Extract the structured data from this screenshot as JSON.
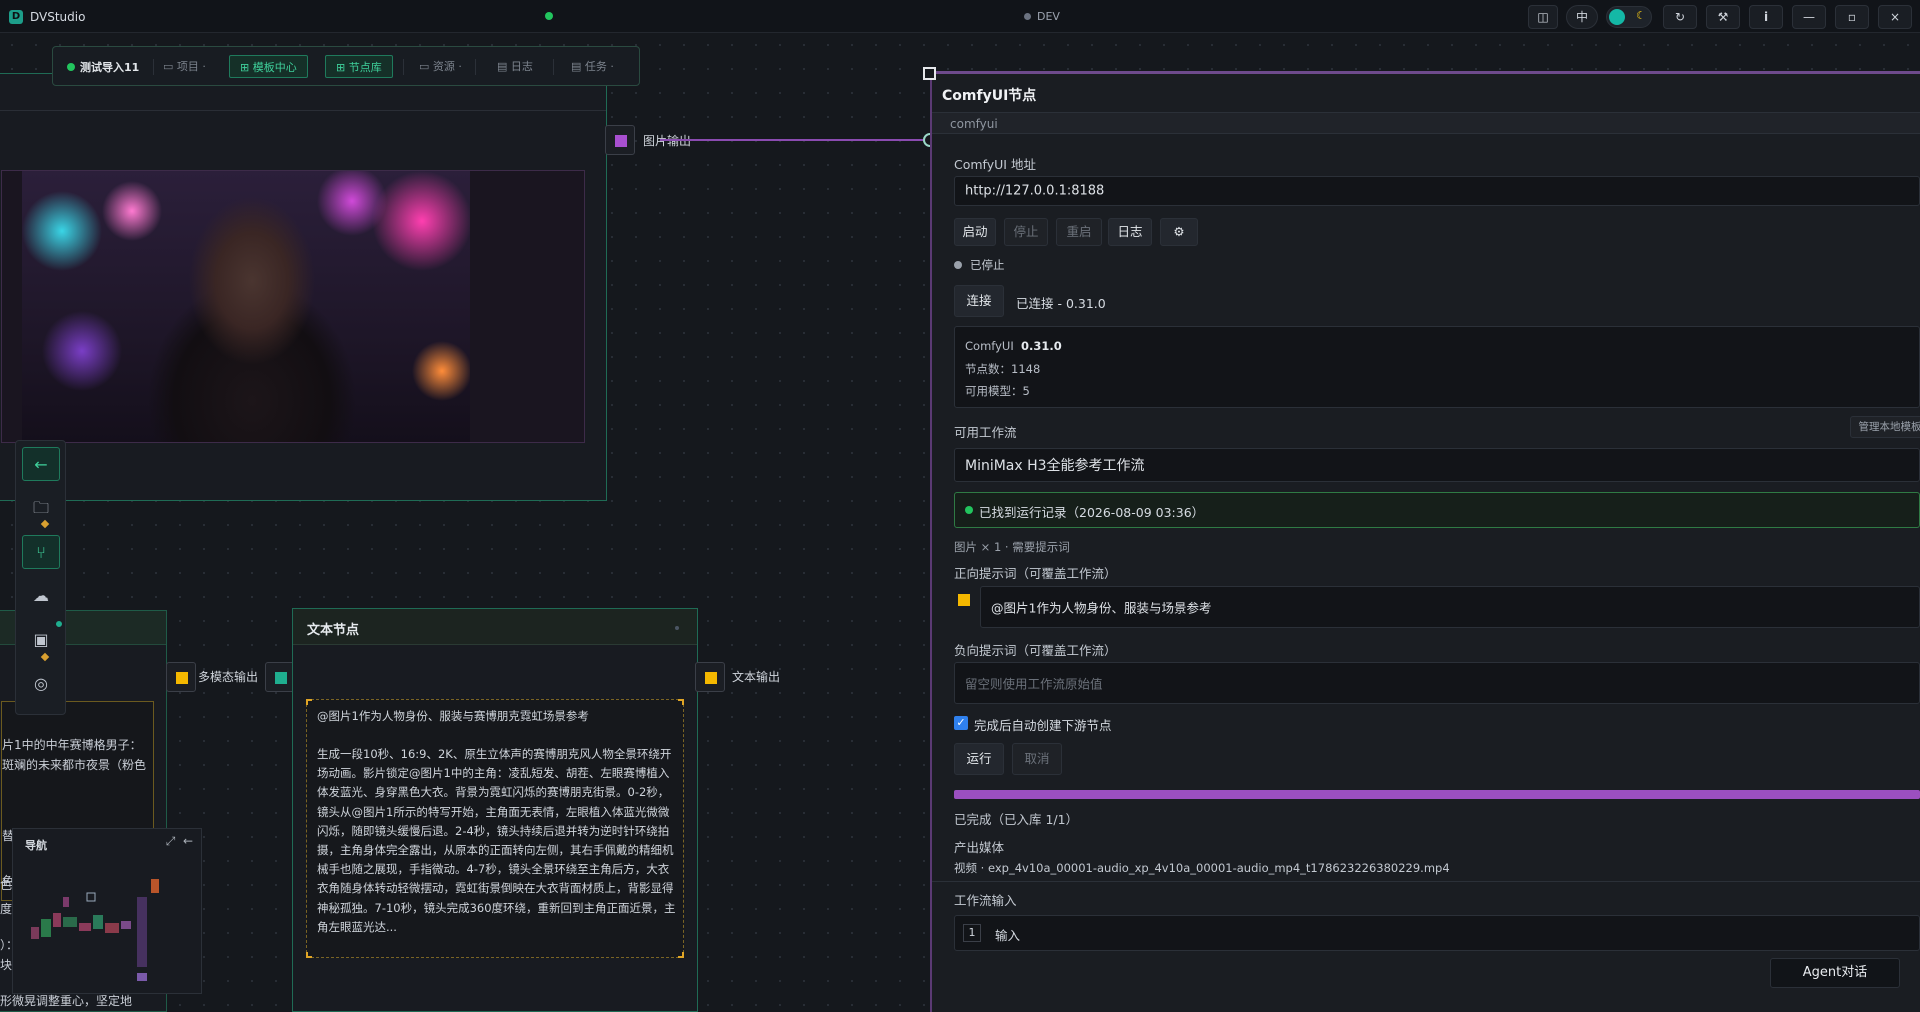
{
  "titlebar": {
    "app_title": "DVStudio",
    "env_label": "DEV",
    "lang_button": "中",
    "refresh_icon": "↻",
    "tools_icon": "⚒",
    "info_icon": "i",
    "minimize_icon": "—",
    "maximize_icon": "▫",
    "close_icon": "×"
  },
  "toolbar": {
    "project_name": "测试导入11",
    "tabs": [
      {
        "label": "项目",
        "icon": "folder-icon"
      },
      {
        "label": "模板中心",
        "icon": "grid-icon"
      },
      {
        "label": "节点库",
        "icon": "grid-icon"
      },
      {
        "label": "资源",
        "icon": "folder-icon"
      },
      {
        "label": "日志",
        "icon": "log-icon"
      },
      {
        "label": "任务",
        "icon": "task-icon"
      }
    ]
  },
  "image_node": {
    "output_port_label": "图片输出"
  },
  "left_node": {
    "port_label": "多模态输出",
    "lines": [
      "片1中的中年赛博格男子：",
      "斑斓的未来都市夜景（粉色",
      "替",
      "色",
      "度",
      "）：",
      "块",
      "形微晃调整重心，坚定地"
    ]
  },
  "navigator": {
    "title": "导航"
  },
  "text_node": {
    "title": "文本节点",
    "output_label": "文本输出",
    "line1": "@图片1作为人物身份、服装与赛博朋克霓虹场景参考",
    "body": "生成一段10秒、16:9、2K、原生立体声的赛博朋克风人物全景环绕开场动画。影片锁定@图片1中的主角：凌乱短发、胡茬、左眼赛博植入体发蓝光、身穿黑色大衣。背景为霓虹闪烁的赛博朋克街景。0-2秒，镜头从@图片1所示的特写开始，主角面无表情，左眼植入体蓝光微微闪烁，随即镜头缓慢后退。2-4秒，镜头持续后退并转为逆时针环绕拍摄，主角身体完全露出，从原本的正面转向左侧，其右手佩戴的精细机械手也随之展现，手指微动。4-7秒，镜头全景环绕至主角后方，大衣衣角随身体转动轻微摆动，霓虹街景倒映在大衣背面材质上，背影显得神秘孤独。7-10秒，镜头完成360度环绕，重新回到主角正面近景，主角左眼蓝光达..."
  },
  "panel": {
    "title": "ComfyUI节点",
    "subtitle": "comfyui",
    "address_label": "ComfyUI 地址",
    "address_value": "http://127.0.0.1:8188",
    "buttons": {
      "start": "启动",
      "stop": "停止",
      "restart": "重启",
      "log": "日志",
      "settings": "⚙"
    },
    "status": "已停止",
    "connect_button": "连接",
    "connected_text": "已连接 - 0.31.0",
    "info": {
      "line1_label": "ComfyUI",
      "line1_value": "0.31.0",
      "line2": "节点数：1148",
      "line3": "可用模型：5"
    },
    "workflows_label": "可用工作流",
    "manage_button": "管理本地模板",
    "workflow_selected": "MiniMax H3全能参考工作流",
    "found_record": "已找到运行记录（2026-08-09 03:36）",
    "requirement": "图片 × 1 · 需要提示词",
    "positive_label": "正向提示词（可覆盖工作流）",
    "positive_value": "@图片1作为人物身份、服装与场景参考",
    "negative_label": "负向提示词（可覆盖工作流）",
    "negative_placeholder": "留空则使用工作流原始值",
    "auto_create_label": "完成后自动创建下游节点",
    "run_button": "运行",
    "cancel_button": "取消",
    "progress": 1.0,
    "done_text": "已完成（已入库 1/1）",
    "output_media_label": "产出媒体",
    "output_media_value": "视频 · exp_4v10a_00001-audio_xp_4v10a_00001-audio_mp4_t178623226380229.mp4",
    "workflow_input_label": "工作流输入",
    "input_index": "1",
    "input_label": "输入"
  },
  "agent_button": "Agent对话",
  "colors": {
    "accent_green": "#3fd19b",
    "port_purple": "#a84fd0",
    "port_yellow": "#f5b800",
    "port_teal": "#1fae8f",
    "connection": "#8a4bb0"
  }
}
